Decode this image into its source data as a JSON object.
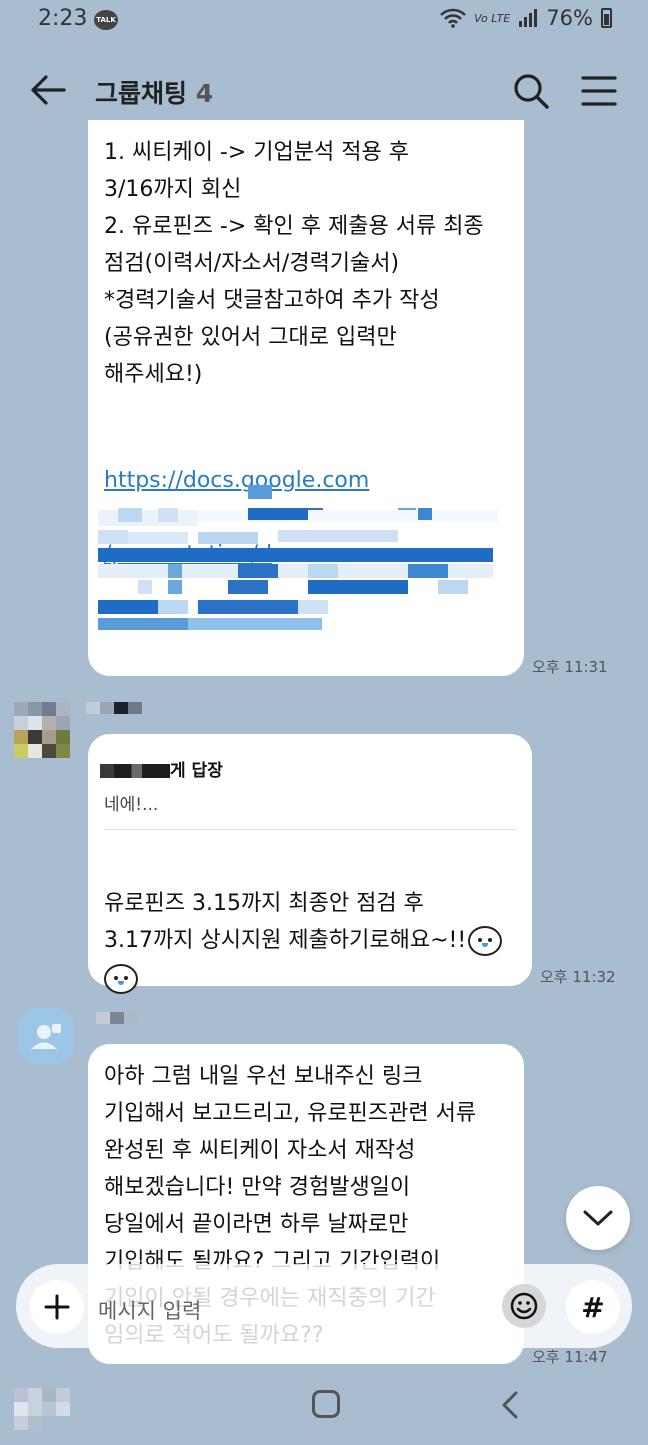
{
  "status_bar": {
    "time": "2:23",
    "talk_badge": "TALK",
    "network": "Vo LTE",
    "battery": "76%"
  },
  "header": {
    "title": "그룹채팅",
    "member_count": "4"
  },
  "messages": [
    {
      "text": "1. 씨티케이 -> 기업분석 적용 후\n3/16까지 회신\n2. 유로핀즈 -> 확인 후 제출용 서류 최종\n점검(이력서/자소서/경력기술서)\n*경력기술서 댓글참고하여 추가 작성\n(공유권한 있어서 그대로 입력만\n해주세요!)",
      "link_line1": "https://docs.google.com",
      "link_line2": "/presentation/d",
      "time": "오후 11:31"
    },
    {
      "reply_to": "게 답장",
      "reply_quote": "네에!...",
      "text": "유로핀즈 3.15까지 최종안 점검 후\n3.17까지 상시지원 제출하기로해요~!!",
      "time": "오후 11:32"
    },
    {
      "text": "아하 그럼 내일 우선 보내주신 링크\n기입해서 보고드리고, 유로핀즈관련 서류\n완성된 후 씨티케이 자소서 재작성\n해보겠습니다! 만약 경험발생일이\n당일에서 끝이라면 하루 날짜로만\n기입해도 될까요? 그리고 기간입력이\n기입이 안될 경우에는 재직중의 기간\n임의로 적어도 될까요??",
      "time": "오후 11:47"
    }
  ],
  "input": {
    "placeholder": "메시지 입력",
    "hash_label": "#"
  },
  "colors": {
    "background": "#a9bdd0",
    "bubble": "#ffffff",
    "link": "#2a7bc1"
  }
}
